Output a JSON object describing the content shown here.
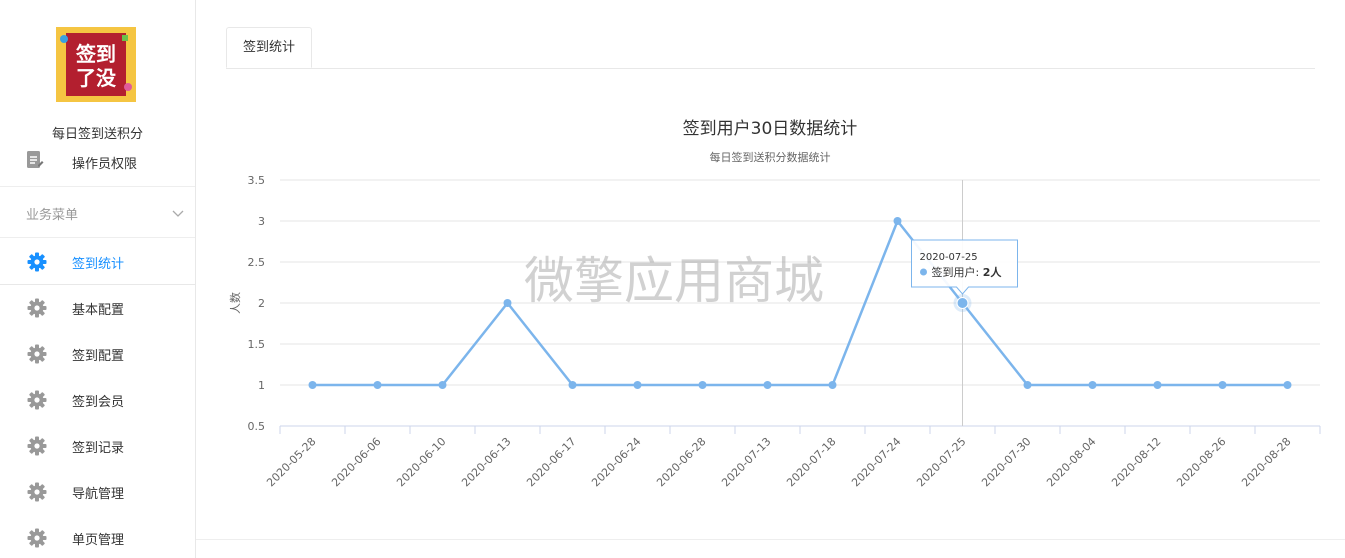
{
  "sidebar": {
    "app_name": "每日签到送积分",
    "logo_text": [
      "签到",
      "了没"
    ],
    "clipped_item": {
      "label": "操作员权限",
      "icon": "edit-document-icon"
    },
    "group_title": "业务菜单",
    "items": [
      {
        "label": "签到统计",
        "active": true,
        "icon": "gear-icon"
      },
      {
        "label": "基本配置",
        "active": false,
        "icon": "gear-icon"
      },
      {
        "label": "签到配置",
        "active": false,
        "icon": "gear-icon"
      },
      {
        "label": "签到会员",
        "active": false,
        "icon": "gear-icon"
      },
      {
        "label": "签到记录",
        "active": false,
        "icon": "gear-icon"
      },
      {
        "label": "导航管理",
        "active": false,
        "icon": "gear-icon"
      },
      {
        "label": "单页管理",
        "active": false,
        "icon": "gear-icon"
      }
    ]
  },
  "tabs": [
    {
      "label": "签到统计",
      "active": true
    }
  ],
  "watermark": "微擎应用商城",
  "tooltip": {
    "title": "2020-07-25",
    "series": "签到用户",
    "value": "2人"
  },
  "colors": {
    "accent": "#1890ff",
    "line": "#7cb5ec",
    "icon_gray": "#999999"
  },
  "chart_data": {
    "type": "line",
    "title": "签到用户30日数据统计",
    "subtitle": "每日签到送积分数据统计",
    "ylabel": "人数",
    "xlabel": "",
    "ylim": [
      0.5,
      3.5
    ],
    "yticks": [
      "0.5",
      "1",
      "1.5",
      "2",
      "2.5",
      "3",
      "3.5"
    ],
    "grid": true,
    "categories": [
      "2020-05-28",
      "2020-06-06",
      "2020-06-10",
      "2020-06-13",
      "2020-06-17",
      "2020-06-24",
      "2020-06-28",
      "2020-07-13",
      "2020-07-18",
      "2020-07-24",
      "2020-07-25",
      "2020-07-30",
      "2020-08-04",
      "2020-08-12",
      "2020-08-26",
      "2020-08-28"
    ],
    "series": [
      {
        "name": "签到用户",
        "values": [
          1,
          1,
          1,
          2,
          1,
          1,
          1,
          1,
          1,
          3,
          2,
          1,
          1,
          1,
          1,
          1
        ]
      }
    ],
    "highlight_category": "2020-07-25"
  }
}
